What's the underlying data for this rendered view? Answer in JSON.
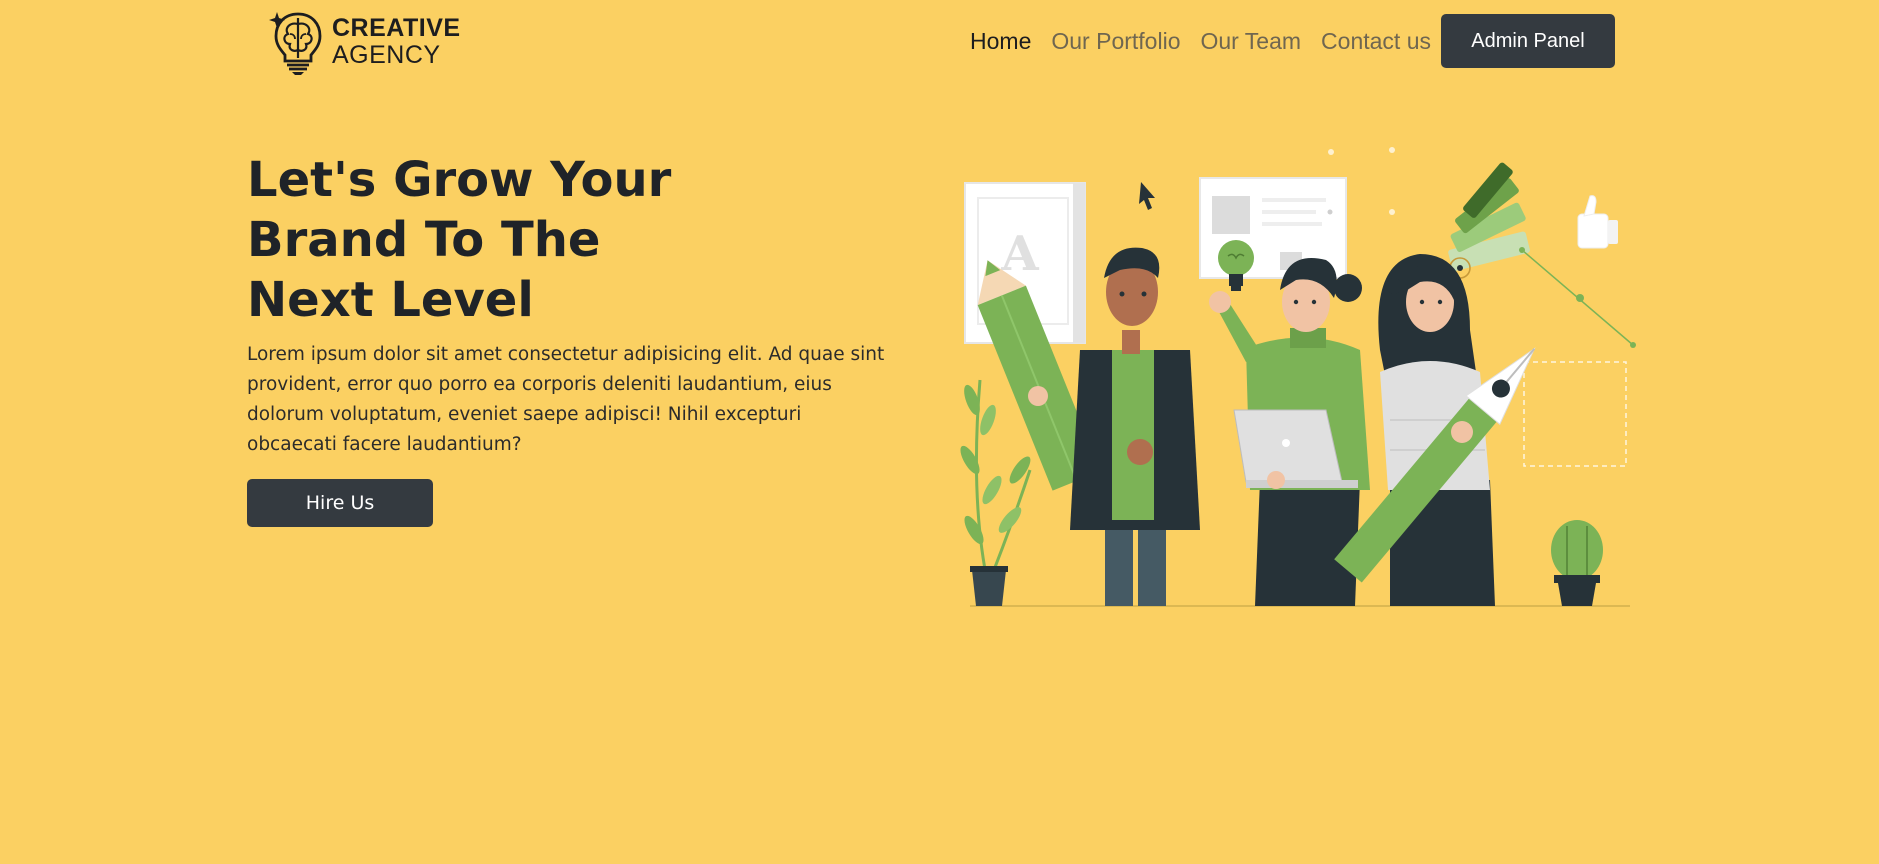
{
  "navbar": {
    "logo": {
      "line1": "CREATIVE",
      "line2": "AGENCY",
      "icon": "brain-lightbulb-icon"
    },
    "links": [
      {
        "label": "Home",
        "active": true
      },
      {
        "label": "Our Portfolio",
        "active": false
      },
      {
        "label": "Our Team",
        "active": false
      },
      {
        "label": "Contact us",
        "active": false
      }
    ],
    "admin_button": "Admin Panel"
  },
  "hero": {
    "title_lines": [
      "Let's Grow Your",
      "Brand To The",
      "Next Level"
    ],
    "description": "Lorem ipsum dolor sit amet consectetur adipisicing elit. Ad quae sint provident, error quo porro ea corporis deleniti laudantium, eius dolorum voluptatum, eveniet saepe adipisci! Nihil excepturi obcaecati facere laudantium?",
    "cta_button": "Hire Us",
    "illustration": "creative-team-illustration"
  },
  "colors": {
    "background": "#FBD062",
    "dark_button": "#343a40",
    "accent_green": "#7cb356",
    "dark_ink": "#263238"
  }
}
